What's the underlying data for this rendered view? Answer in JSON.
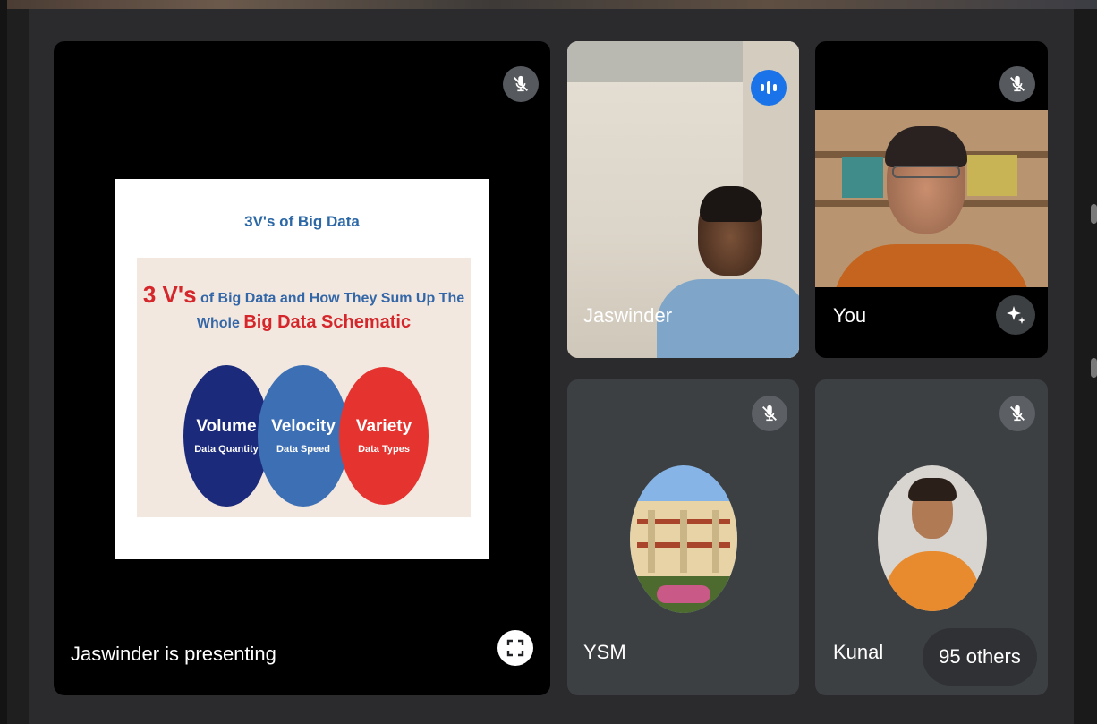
{
  "presentation": {
    "presenting_label": "Jaswinder is presenting",
    "slide": {
      "title": "3V's of Big Data",
      "headline_big": "3 V's",
      "headline_rest1": " of Big Data and How They Sum Up The",
      "headline_rest2": "Whole ",
      "headline_red": "Big Data Schematic",
      "circles": [
        {
          "main": "Volume",
          "sub": "Data Quantity",
          "color": "#1b2a7a"
        },
        {
          "main": "Velocity",
          "sub": "Data Speed",
          "color": "#3d6fb5"
        },
        {
          "main": "Variety",
          "sub": "Data Types",
          "color": "#e5332f"
        }
      ]
    }
  },
  "participants": [
    {
      "name": "Jaswinder",
      "status": "speaking",
      "icon": "speaking-indicator-icon"
    },
    {
      "name": "You",
      "status": "muted",
      "icon": "mic-off-icon"
    },
    {
      "name": "YSM",
      "status": "muted",
      "icon": "mic-off-icon"
    },
    {
      "name": "Kunal",
      "status": "muted",
      "icon": "mic-off-icon"
    }
  ],
  "others": {
    "label": "95 others"
  },
  "colors": {
    "speaking": "#1a73e8",
    "tile": "#3c4043",
    "background": "#2b2b2e"
  }
}
